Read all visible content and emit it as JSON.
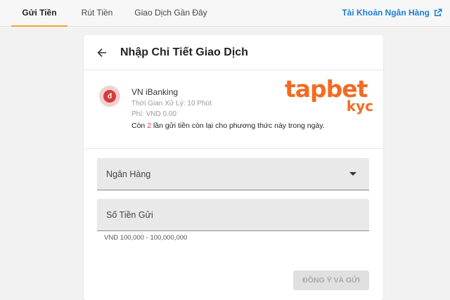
{
  "tabs": [
    {
      "label": "Gửi Tiền",
      "active": true
    },
    {
      "label": "Rút Tiền",
      "active": false
    },
    {
      "label": "Giao Dịch Gần Đây",
      "active": false
    }
  ],
  "bank_account_link": {
    "label": "Tài Khoản Ngân Hàng",
    "icon": "external-link-icon"
  },
  "card": {
    "title": "Nhập Chi Tiết Giao Dịch",
    "back_icon": "arrow-left-icon"
  },
  "method": {
    "name": "VN iBanking",
    "processing_time": "Thời Gian Xử Lý: 10 Phút",
    "fee": "Phí: VND 0.00",
    "remaining_prefix": "Còn ",
    "remaining_count": "2",
    "remaining_suffix": " lần gửi tiền còn lại cho phương thức này trong ngày."
  },
  "watermark": {
    "main": "tapbet",
    "sub": "kyc"
  },
  "form": {
    "bank_label": "Ngân Hàng",
    "amount_label": "Số Tiền Gửi",
    "amount_range": "VND 100,000 - 100,000,000",
    "submit_label": "ĐỒNG Ý VÀ GỬI"
  },
  "colors": {
    "accent_tab": "#f4a430",
    "link": "#1c7ed6",
    "highlight": "#e53935",
    "watermark": "#f26b24"
  }
}
